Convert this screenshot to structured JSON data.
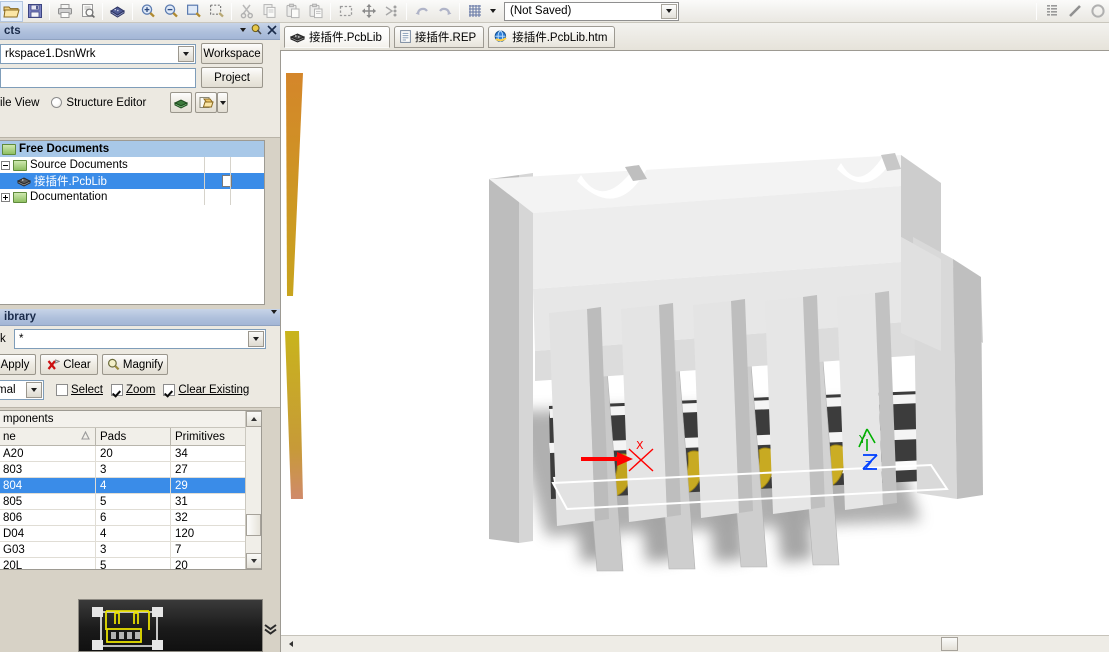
{
  "app": {
    "title_combo_value": "(Not Saved)"
  },
  "toolbar": {
    "buttons": [
      {
        "name": "open-document-icon",
        "label": "Open Document"
      },
      {
        "name": "save-icon",
        "label": "Save"
      },
      {
        "name": "print-icon",
        "label": "Print"
      },
      {
        "name": "print-preview-icon",
        "label": "Print Preview"
      },
      {
        "name": "open-library-icon",
        "label": "Open Library"
      },
      {
        "name": "zoom-in-icon",
        "label": "Zoom In"
      },
      {
        "name": "zoom-out-icon",
        "label": "Zoom Out"
      },
      {
        "name": "zoom-document-icon",
        "label": "Fit Document"
      },
      {
        "name": "zoom-area-icon",
        "label": "Zoom Area"
      },
      {
        "name": "cut-icon",
        "label": "Cut"
      },
      {
        "name": "copy-icon",
        "label": "Copy"
      },
      {
        "name": "paste-icon",
        "label": "Paste"
      },
      {
        "name": "paste-special-icon",
        "label": "Paste Special"
      },
      {
        "name": "select-area-icon",
        "label": "Select Inside Area"
      },
      {
        "name": "move-icon",
        "label": "Move Selection"
      },
      {
        "name": "deselect-all-icon",
        "label": "Clear Selection"
      },
      {
        "name": "undo-icon",
        "label": "Undo"
      },
      {
        "name": "redo-icon",
        "label": "Redo"
      },
      {
        "name": "snap-grid-icon",
        "label": "Snap Grid"
      }
    ],
    "right_buttons": [
      {
        "name": "list-icon",
        "label": "List"
      },
      {
        "name": "line-tool-icon",
        "label": "Line"
      },
      {
        "name": "arc-tool-icon",
        "label": "Arc"
      }
    ]
  },
  "projects_panel": {
    "title": "cts",
    "title_full": "Projects",
    "workspace_value": "rkspace1.DsnWrk",
    "workspace_button": "Workspace",
    "project_value": "",
    "project_button": "Project",
    "view_mode_file": "ile View",
    "view_mode_structure": "Structure Editor",
    "tree": [
      {
        "label": "Free Documents",
        "icon": "folder-green-icon",
        "indent": 0,
        "state": "selected-bold",
        "expander": "none"
      },
      {
        "label": "Source Documents",
        "icon": "folder-green-icon",
        "indent": 1,
        "state": "normal",
        "expander": "minus"
      },
      {
        "label": "接插件.PcbLib",
        "icon": "pcblib-icon",
        "indent": 2,
        "state": "selected",
        "expander": "none",
        "badge": "document-icon"
      },
      {
        "label": "Documentation",
        "icon": "folder-green-icon",
        "indent": 1,
        "state": "normal",
        "expander": "plus"
      }
    ]
  },
  "library_panel": {
    "title": "ibrary",
    "title_full": "PCB Library",
    "mask_label": "k",
    "mask_value": "*",
    "apply_button": "Apply",
    "clear_button": "Clear",
    "magnify_button": "Magnify",
    "zoom_select_value": "mal",
    "zoom_select_full": "Normal",
    "checkbox_select": "Select",
    "checkbox_select_checked": false,
    "checkbox_zoom": "Zoom",
    "checkbox_zoom_checked": true,
    "checkbox_clear_existing": "Clear Existing",
    "checkbox_clear_existing_checked": true
  },
  "components_grid": {
    "caption": "mponents",
    "caption_full": "Components",
    "columns": [
      "ne",
      "Pads",
      "Primitives"
    ],
    "columns_full": [
      "Name",
      "Pads",
      "Primitives"
    ],
    "sort_column_index": 0,
    "sort_direction": "ascending",
    "rows": [
      {
        "name": "A20",
        "pads": "20",
        "primitives": "34",
        "selected": false
      },
      {
        "name": "803",
        "pads": "3",
        "primitives": "27",
        "selected": false
      },
      {
        "name": "804",
        "pads": "4",
        "primitives": "29",
        "selected": true
      },
      {
        "name": "805",
        "pads": "5",
        "primitives": "31",
        "selected": false
      },
      {
        "name": "806",
        "pads": "6",
        "primitives": "32",
        "selected": false
      },
      {
        "name": "D04",
        "pads": "4",
        "primitives": "120",
        "selected": false
      },
      {
        "name": "G03",
        "pads": "3",
        "primitives": "7",
        "selected": false
      },
      {
        "name": "20L",
        "pads": "5",
        "primitives": "20",
        "selected": false
      }
    ]
  },
  "footprint_preview": {
    "name": "footprint-preview",
    "background": "#1b1b1b",
    "silkscreen_color": "#e8e000",
    "pad_color": "#c8c8c8"
  },
  "document_tabs": [
    {
      "label": "接插件.PcbLib",
      "icon": "pcblib-icon",
      "active": true
    },
    {
      "label": "接插件.REP",
      "icon": "report-icon",
      "active": false
    },
    {
      "label": "接插件.PcbLib.htm",
      "icon": "html-icon",
      "active": false
    }
  ],
  "viewport": {
    "name": "pcb-3d-viewport",
    "background": "#ffffff",
    "model": "3D connector housing with 4 gold plated pads",
    "axis_indicator": {
      "x_label": "X",
      "x_color": "#ff0000",
      "y_label": "Y",
      "y_color": "#00c000",
      "z_label": "Z",
      "z_color": "#0040ff"
    },
    "colors": {
      "housing_light": "#f2f2f2",
      "housing_mid": "#dcdcdc",
      "housing_shadow": "#b5b5b5",
      "board_dark": "#3b3b3b",
      "pad_gold": "#c8aa20",
      "pin_gray": "#c6c6c6",
      "edge_wedge": "#d8902a"
    }
  }
}
